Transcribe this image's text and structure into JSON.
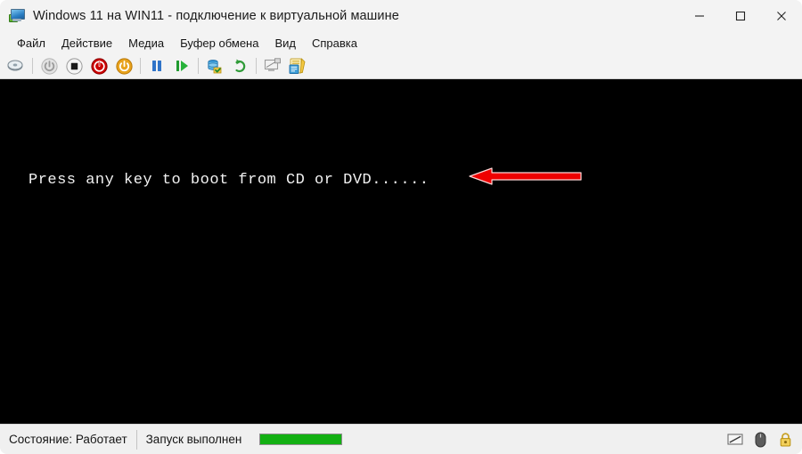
{
  "window": {
    "title": "Windows 11 на WIN11 - подключение к виртуальной машине",
    "icon": "virtual-machine-icon",
    "controls": {
      "minimize": "minimize-button",
      "maximize": "maximize-button",
      "close": "close-button"
    }
  },
  "menu": {
    "items": [
      {
        "label": "Файл"
      },
      {
        "label": "Действие"
      },
      {
        "label": "Медиа"
      },
      {
        "label": "Буфер обмена"
      },
      {
        "label": "Вид"
      },
      {
        "label": "Справка"
      }
    ]
  },
  "toolbar": {
    "buttons": [
      {
        "name": "media-cd-icon",
        "tooltip": "Медиа"
      },
      {
        "name": "power-off-icon",
        "tooltip": "Выключить"
      },
      {
        "name": "shutdown-icon",
        "tooltip": "Завершение работы"
      },
      {
        "name": "turn-off-icon",
        "tooltip": "Выключение"
      },
      {
        "name": "start-power-icon",
        "tooltip": "Пуск"
      },
      {
        "name": "pause-icon",
        "tooltip": "Приостановить"
      },
      {
        "name": "resume-icon",
        "tooltip": "Возобновить"
      },
      {
        "name": "checkpoint-icon",
        "tooltip": "Контрольная точка"
      },
      {
        "name": "revert-icon",
        "tooltip": "Возврат"
      },
      {
        "name": "enhanced-session-icon",
        "tooltip": "Расширенный сеанс"
      },
      {
        "name": "settings-icon",
        "tooltip": "Параметры"
      }
    ]
  },
  "console": {
    "text": "Press any key to boot from CD or DVD......",
    "background": "#000000",
    "foreground": "#f2f2f2",
    "annotation": {
      "name": "red-arrow-annotation",
      "color": "#ee0000",
      "direction": "left"
    }
  },
  "statusbar": {
    "state_label": "Состояние: Работает",
    "task_label": "Запуск выполнен",
    "progress_color": "#13b013",
    "icons": [
      {
        "name": "screen-icon"
      },
      {
        "name": "mouse-icon"
      },
      {
        "name": "lock-icon"
      }
    ]
  }
}
